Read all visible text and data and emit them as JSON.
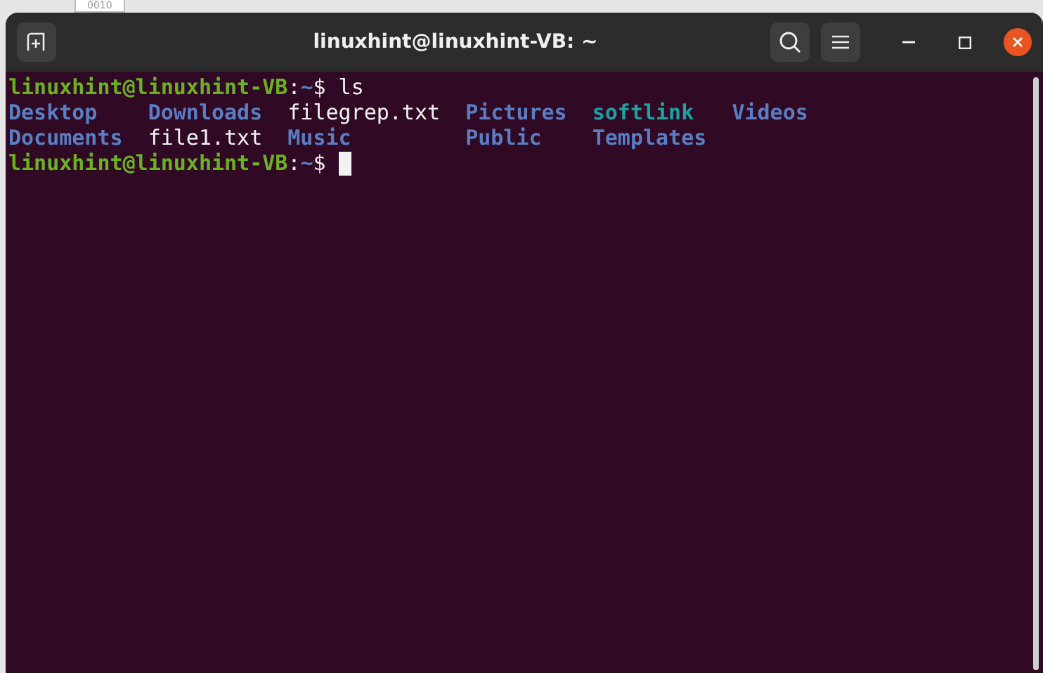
{
  "desktop_label": "0010",
  "window": {
    "title": "linuxhint@linuxhint-VB: ~"
  },
  "terminal": {
    "lines": [
      {
        "kind": "prompt",
        "user_host": "linuxhint@linuxhint-VB",
        "separator": ":",
        "path": "~",
        "symbol": "$",
        "command": "ls"
      },
      {
        "kind": "listing",
        "entries": [
          {
            "name": "Desktop",
            "kind": "dir"
          },
          {
            "name": "Documents",
            "kind": "dir"
          },
          {
            "name": "Downloads",
            "kind": "dir"
          },
          {
            "name": "file1.txt",
            "kind": "file"
          },
          {
            "name": "filegrep.txt",
            "kind": "file"
          },
          {
            "name": "Music",
            "kind": "dir"
          },
          {
            "name": "Pictures",
            "kind": "dir"
          },
          {
            "name": "Public",
            "kind": "dir"
          },
          {
            "name": "softlink",
            "kind": "link"
          },
          {
            "name": "Templates",
            "kind": "dir"
          },
          {
            "name": "Videos",
            "kind": "dir"
          }
        ]
      },
      {
        "kind": "prompt",
        "user_host": "linuxhint@linuxhint-VB",
        "separator": ":",
        "path": "~",
        "symbol": "$",
        "cursor": true
      }
    ]
  }
}
